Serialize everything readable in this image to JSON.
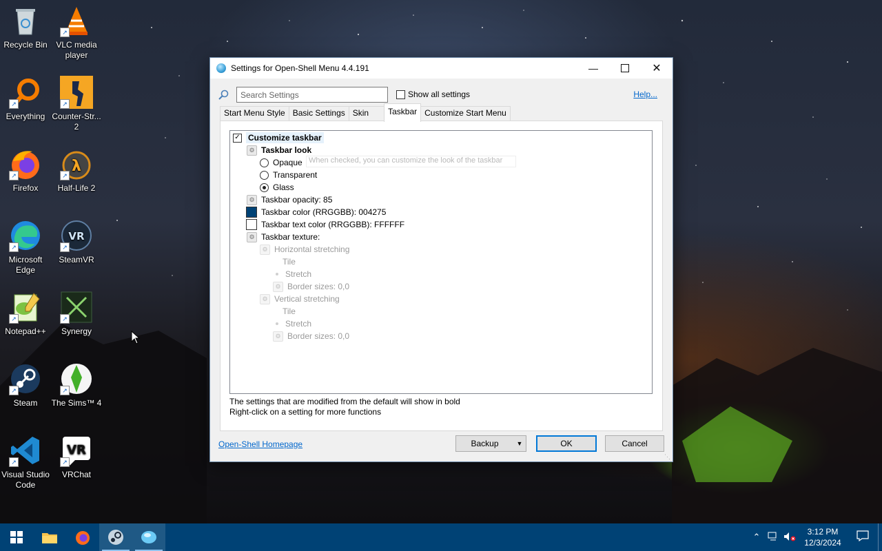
{
  "desktop": {
    "icons": [
      {
        "label": "Recycle Bin",
        "icon": "recycle-bin-icon"
      },
      {
        "label": "VLC media player",
        "icon": "vlc-icon"
      },
      {
        "label": "Everything",
        "icon": "everything-search-icon"
      },
      {
        "label": "Counter-Str... 2",
        "icon": "counter-strike-icon"
      },
      {
        "label": "Firefox",
        "icon": "firefox-icon"
      },
      {
        "label": "Half-Life 2",
        "icon": "half-life-icon"
      },
      {
        "label": "Microsoft Edge",
        "icon": "edge-icon"
      },
      {
        "label": "SteamVR",
        "icon": "steamvr-icon"
      },
      {
        "label": "Notepad++",
        "icon": "notepad-plus-plus-icon"
      },
      {
        "label": "Synergy",
        "icon": "synergy-icon"
      },
      {
        "label": "Steam",
        "icon": "steam-icon"
      },
      {
        "label": "The Sims™ 4",
        "icon": "sims-icon"
      },
      {
        "label": "Visual Studio Code",
        "icon": "vscode-icon"
      },
      {
        "label": "VRChat",
        "icon": "vrchat-icon"
      }
    ]
  },
  "dialog": {
    "title": "Settings for Open-Shell Menu 4.4.191",
    "search_placeholder": "Search Settings",
    "show_all_label": "Show all settings",
    "help_label": "Help...",
    "tabs": [
      "Start Menu Style",
      "Basic Settings",
      "Skin",
      "Taskbar",
      "Customize Start Menu"
    ],
    "active_tab": "Taskbar",
    "tree": {
      "customize_taskbar": "Customize taskbar",
      "taskbar_look": "Taskbar look",
      "opaque": "Opaque",
      "transparent": "Transparent",
      "glass": "Glass",
      "tooltip": "When checked, you can customize the look of the taskbar",
      "opacity": "Taskbar opacity: 85",
      "color": "Taskbar color (RRGGBB): 004275",
      "text_color": "Taskbar text color (RRGGBB): FFFFFF",
      "texture": "Taskbar texture:",
      "h_stretch": "Horizontal stretching",
      "h_tile": "Tile",
      "h_stretch_opt": "Stretch",
      "h_border": "Border sizes: 0,0",
      "v_stretch": "Vertical stretching",
      "v_tile": "Tile",
      "v_stretch_opt": "Stretch",
      "v_border": "Border sizes: 0,0"
    },
    "colors": {
      "taskbar": "#004275",
      "text": "#FFFFFF"
    },
    "hint_line1": "The settings that are modified from the default will show in bold",
    "hint_line2": "Right-click on a setting for more functions",
    "homepage_label": "Open-Shell Homepage",
    "backup_label": "Backup",
    "ok_label": "OK",
    "cancel_label": "Cancel"
  },
  "taskbar": {
    "time": "3:12 PM",
    "date": "12/3/2024"
  }
}
